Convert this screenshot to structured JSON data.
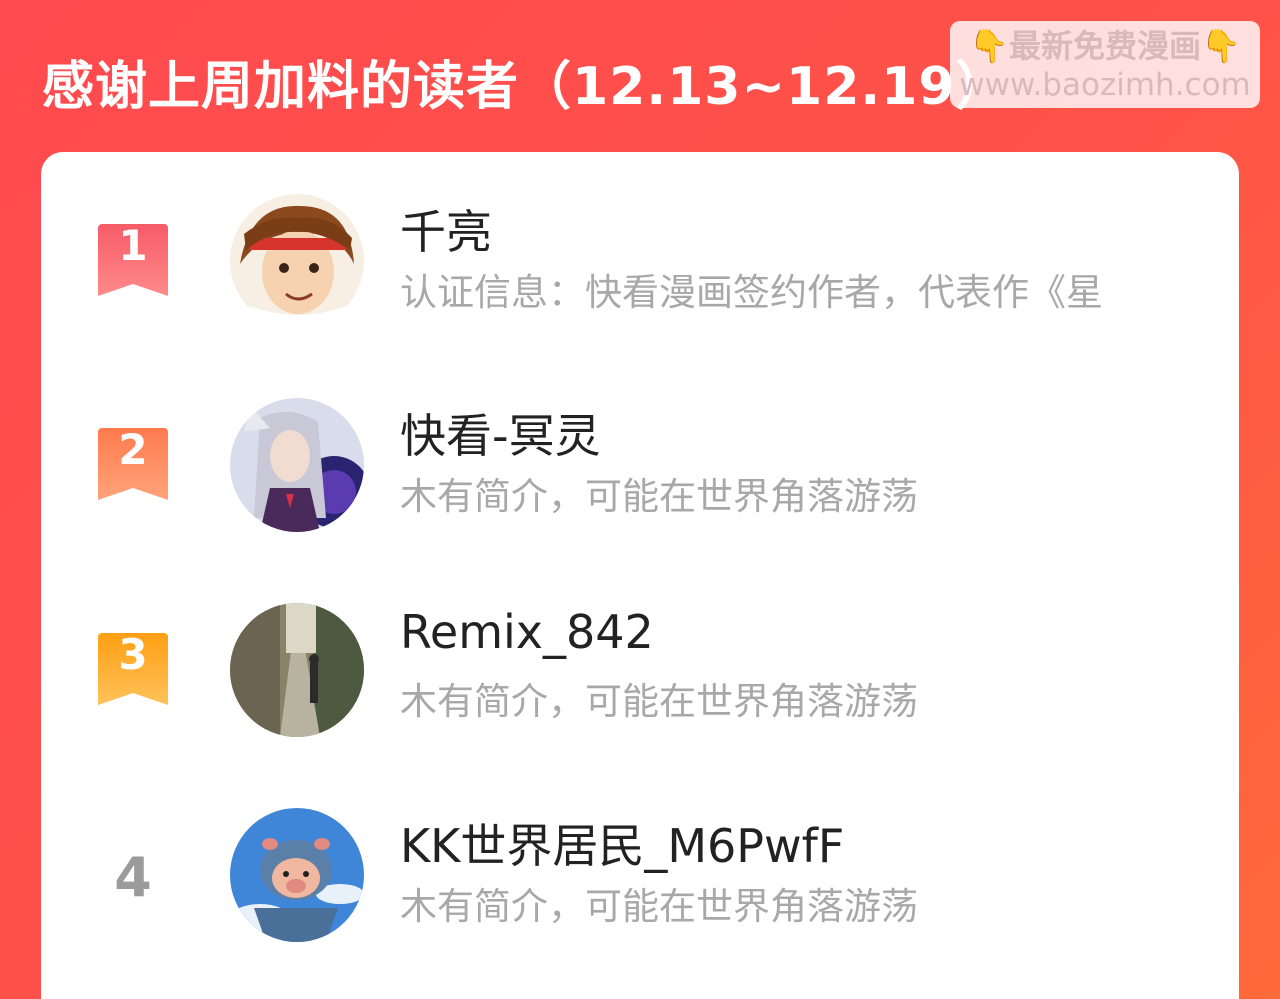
{
  "header": {
    "title": "感谢上周加料的读者（12.13~12.19）"
  },
  "watermark": {
    "line1": "最新免费漫画",
    "line2": "www.baozimh.com",
    "emoji": "👇"
  },
  "colors": {
    "background": "#ff4f48",
    "rank1": "#f65c68",
    "rank2": "#ff8a5c",
    "rank3": "#ffa826",
    "name": "#222222",
    "intro": "#a8a8a8"
  },
  "readers": [
    {
      "rank": "1",
      "name": "千亮",
      "intro": "认证信息：快看漫画签约作者，代表作《星"
    },
    {
      "rank": "2",
      "name": "快看-冥灵",
      "intro": "木有简介，可能在世界角落游荡"
    },
    {
      "rank": "3",
      "name": "Remix_842",
      "intro": "木有简介，可能在世界角落游荡"
    },
    {
      "rank": "4",
      "name": "KK世界居民_M6PwfF",
      "intro": "木有简介，可能在世界角落游荡"
    }
  ]
}
